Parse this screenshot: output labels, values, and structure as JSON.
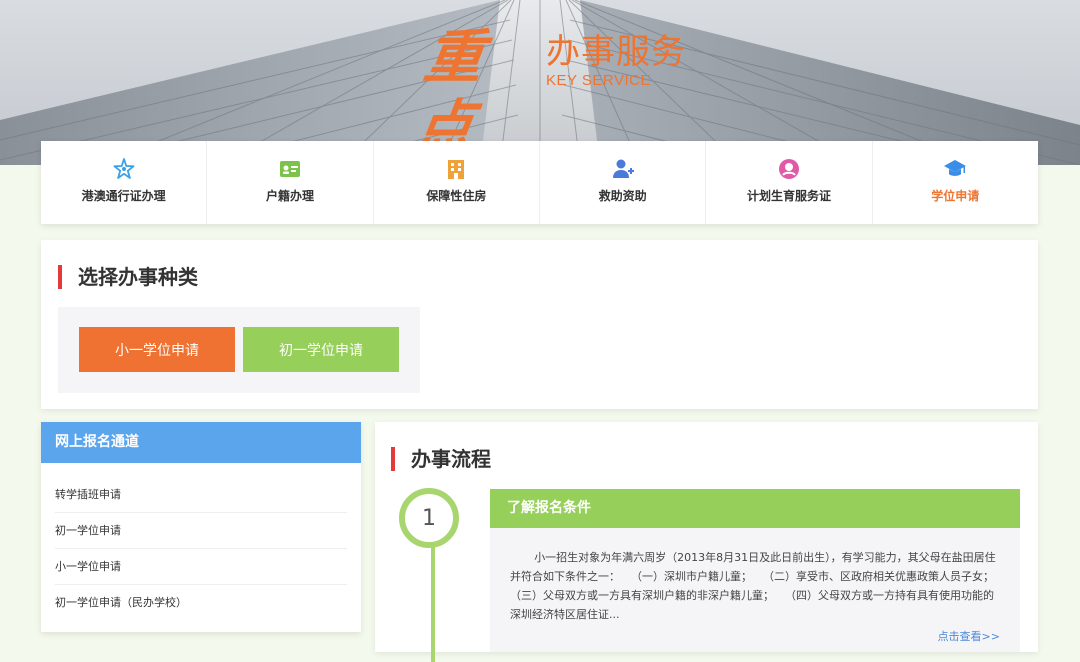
{
  "banner": {
    "brand_big": "重点",
    "brand_title": "办事服务",
    "brand_sub": "KEY SERVICE"
  },
  "services": [
    {
      "label": "港澳通行证办理",
      "icon": "starfish-icon",
      "color": "#3aa0e8"
    },
    {
      "label": "户籍办理",
      "icon": "id-card-icon",
      "color": "#7dc24a"
    },
    {
      "label": "保障性住房",
      "icon": "building-icon",
      "color": "#f0a23a"
    },
    {
      "label": "救助资助",
      "icon": "user-add-icon",
      "color": "#4a7bd8"
    },
    {
      "label": "计划生育服务证",
      "icon": "baby-icon",
      "color": "#e05aa8"
    },
    {
      "label": "学位申请",
      "icon": "graduation-cap-icon",
      "color": "#3a8ee8",
      "active": true
    }
  ],
  "category": {
    "title": "选择办事种类",
    "buttons": [
      "小一学位申请",
      "初一学位申请"
    ]
  },
  "channel": {
    "title": "网上报名通道",
    "items": [
      "转学插班申请",
      "初一学位申请",
      "小一学位申请",
      "初一学位申请（民办学校）"
    ]
  },
  "process": {
    "title": "办事流程",
    "step_number": "1",
    "step_title": "了解报名条件",
    "step_text": "小一招生对象为年满六周岁（2013年8月31日及此日前出生），有学习能力，其父母在盐田居住并符合如下条件之一：　　（一）深圳市户籍儿童；　　（二）享受市、区政府相关优惠政策人员子女；　　（三）父母双方或一方具有深圳户籍的非深户籍儿童；　　（四）父母双方或一方持有具有使用功能的深圳经济特区居住证...",
    "more_label": "点击查看>>"
  },
  "colors": {
    "accent_orange": "#ef7232",
    "accent_green": "#97cf5b",
    "channel_blue": "#5ba5ec",
    "title_bar_red": "#e23b3b",
    "link_blue": "#4a8ad8"
  }
}
